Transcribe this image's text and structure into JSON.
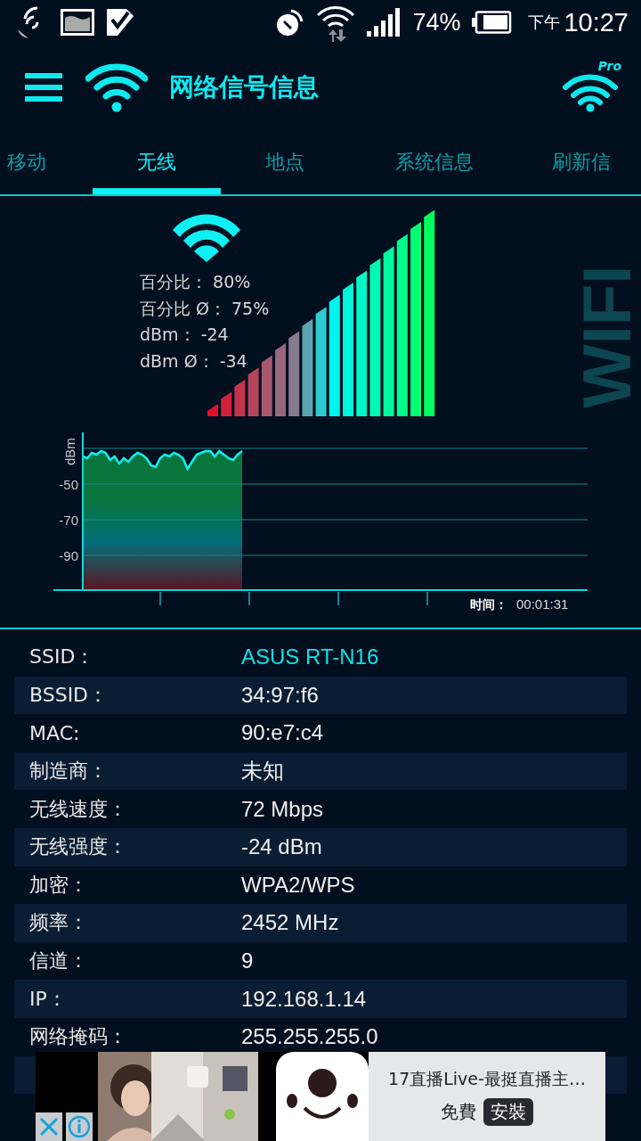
{
  "status_bar": {
    "battery": "74%",
    "time_prefix": "下午",
    "time": "10:27"
  },
  "app_bar": {
    "title": "网络信号信息",
    "badge": "Pro"
  },
  "tabs": [
    {
      "label": "移动",
      "selected": false
    },
    {
      "label": "无线",
      "selected": true
    },
    {
      "label": "地点",
      "selected": false
    },
    {
      "label": "系统信息",
      "selected": false
    },
    {
      "label": "刷新信",
      "selected": false
    }
  ],
  "signal": {
    "stats": [
      "百分比： 80%",
      "百分比 Ø： 75%",
      "dBm： -24",
      "dBm Ø： -34"
    ],
    "side_label": "WIFI"
  },
  "chart": {
    "y_label": "dBm",
    "y_tick_labels": [
      "-50",
      "-70",
      "-90"
    ],
    "time_label": "时间：",
    "time": "00:01:31"
  },
  "details": [
    {
      "label": "SSID：",
      "value": "ASUS RT-N16",
      "highlighted": true
    },
    {
      "label": "BSSID：",
      "value": "34:97:f6",
      "highlighted": false
    },
    {
      "label": "MAC:",
      "value": "90:e7:c4",
      "highlighted": false
    },
    {
      "label": "制造商：",
      "value": "未知",
      "highlighted": false
    },
    {
      "label": "无线速度：",
      "value": "72 Mbps",
      "highlighted": false
    },
    {
      "label": "无线强度：",
      "value": "-24 dBm",
      "highlighted": false
    },
    {
      "label": "加密：",
      "value": "WPA2/WPS",
      "highlighted": false
    },
    {
      "label": "频率：",
      "value": "2452 MHz",
      "highlighted": false
    },
    {
      "label": "信道：",
      "value": "9",
      "highlighted": false
    },
    {
      "label": "IP：",
      "value": "192.168.1.14",
      "highlighted": false
    },
    {
      "label": "网络掩码：",
      "value": "255.255.255.0",
      "highlighted": false
    }
  ],
  "ad": {
    "title": "17直播Live-最挺直播主…",
    "price": "免費",
    "install": "安裝"
  }
}
